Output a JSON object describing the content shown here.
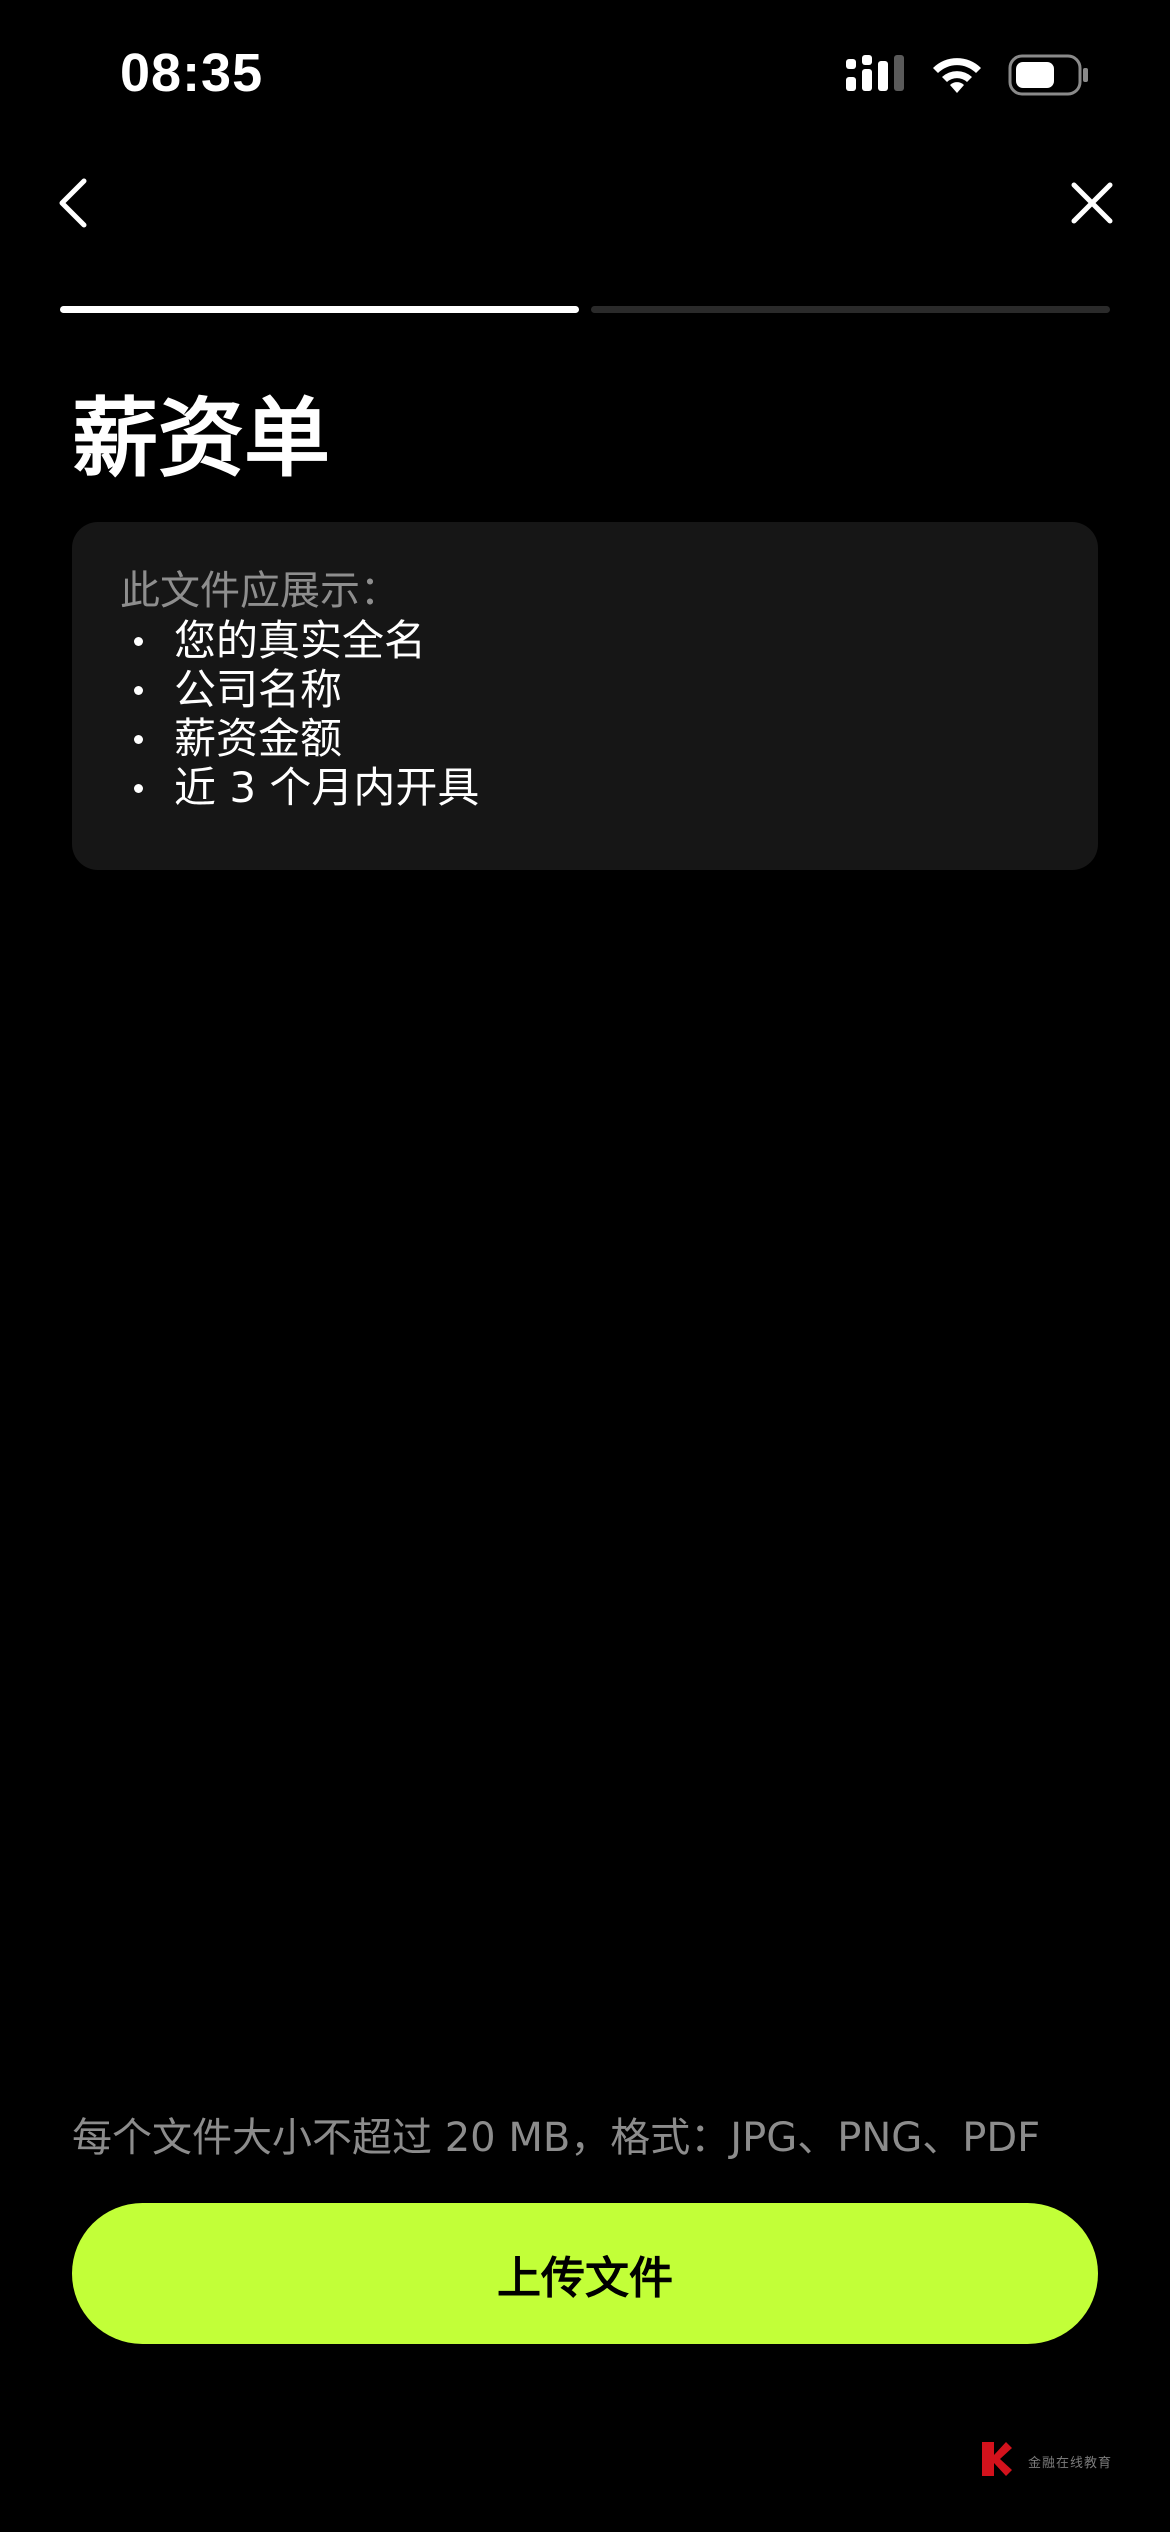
{
  "status_bar": {
    "time": "08:35",
    "icons": [
      "cellular-signal-icon",
      "wifi-icon",
      "battery-icon"
    ],
    "battery_level": 0.55
  },
  "nav": {
    "back_icon": "chevron-left-icon",
    "close_icon": "close-icon"
  },
  "progress": {
    "total_steps": 2,
    "current_step": 1
  },
  "page": {
    "title": "薪资单"
  },
  "requirements": {
    "heading": "此文件应展示：",
    "items": [
      "您的真实全名",
      "公司名称",
      "薪资金额",
      "近 3 个月内开具"
    ]
  },
  "footer": {
    "file_hint": "每个文件大小不超过 20 MB，格式：JPG、PNG、PDF",
    "upload_label": "上传文件"
  },
  "watermark": {
    "text": "金融在线教育",
    "icon": "brand-logo-icon"
  },
  "colors": {
    "background": "#000000",
    "card": "#161616",
    "accent": "#c2ff38",
    "muted_text": "#8c8c8c",
    "progress_inactive": "#2a2a2a"
  }
}
